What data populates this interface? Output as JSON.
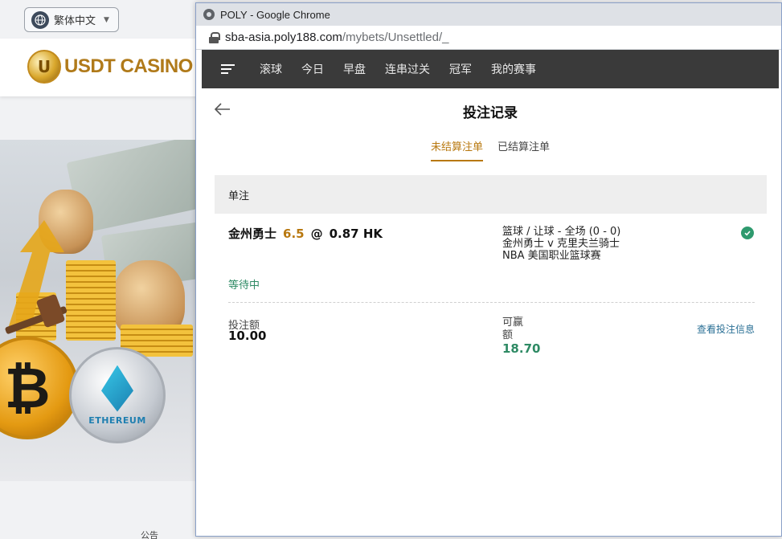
{
  "background": {
    "language": {
      "label": "繁体中文"
    },
    "logo": {
      "coin_letter": "U",
      "text": "USDT CASINO"
    },
    "banner": {
      "eth_label": "ETHEREUM",
      "btc_symbol": "₿"
    },
    "bottom_text": "公告"
  },
  "window": {
    "title": "POLY - Google Chrome",
    "url": {
      "host": "sba-asia.poly188.com",
      "path": "/mybets/Unsettled/_"
    }
  },
  "nav": {
    "items": [
      {
        "label": "滚球"
      },
      {
        "label": "今日"
      },
      {
        "label": "早盘"
      },
      {
        "label": "连串过关"
      },
      {
        "label": "冠军"
      },
      {
        "label": "我的赛事"
      }
    ]
  },
  "page": {
    "title": "投注记录",
    "tabs": [
      {
        "label": "未结算注单",
        "active": true
      },
      {
        "label": "已结算注单",
        "active": false
      }
    ]
  },
  "bet": {
    "section": "单注",
    "selection": "金州勇士",
    "handicap": "6.5",
    "at": "@",
    "odds": "0.87 HK",
    "market": "篮球 / 让球 - 全场 (0 - 0)",
    "match": "金州勇士 v 克里夫兰骑士",
    "league": "NBA 美国职业篮球赛",
    "status": "等待中",
    "stake_label": "投注额",
    "stake_value": "10.00",
    "payout_label": "可赢额",
    "payout_value": "18.70",
    "view_link": "查看投注信息"
  },
  "colors": {
    "accent": "#b8780f",
    "success": "#2e8a64",
    "navbar": "#3a3a3a",
    "link": "#2a6f95"
  }
}
